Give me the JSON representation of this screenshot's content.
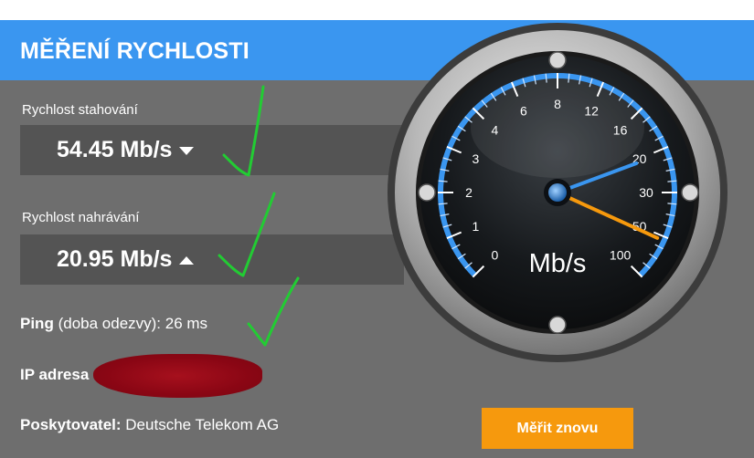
{
  "title": "MĚŘENÍ RYCHLOSTI",
  "download": {
    "label": "Rychlost stahování",
    "value": "54.45 Mb/s"
  },
  "upload": {
    "label": "Rychlost nahrávání",
    "value": "20.95 Mb/s"
  },
  "ping": {
    "label": "Ping",
    "note": "(doba odezvy):",
    "value": "26 ms"
  },
  "ip": {
    "label": "IP adresa"
  },
  "provider": {
    "label": "Poskytovatel:",
    "value": "Deutsche Telekom AG"
  },
  "button": {
    "label": "Měřit znovu"
  },
  "gauge": {
    "unit": "Mb/s",
    "ticks": [
      "0",
      "1",
      "2",
      "3",
      "4",
      "6",
      "8",
      "12",
      "16",
      "20",
      "30",
      "50",
      "100"
    ],
    "download_needle": 54.45,
    "upload_needle": 20.95
  },
  "colors": {
    "header": "#3a96f0",
    "panel": "#6e6e6e",
    "button": "#f6990d",
    "needle_blue": "#3a96f0",
    "needle_orange": "#f6990d"
  }
}
